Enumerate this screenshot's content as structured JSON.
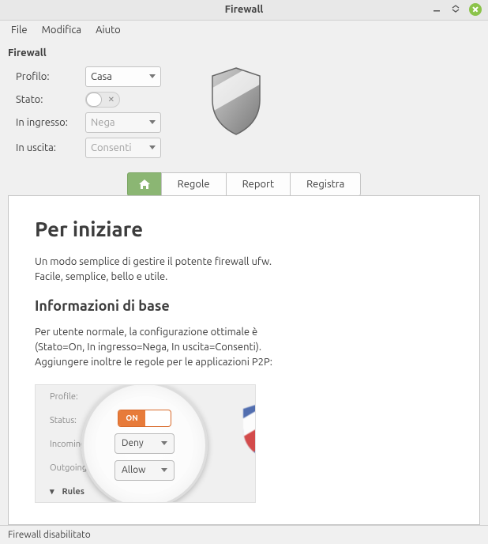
{
  "window": {
    "title": "Firewall"
  },
  "menu": {
    "file": "File",
    "edit": "Modifica",
    "help": "Aiuto"
  },
  "section": {
    "title": "Firewall"
  },
  "settings": {
    "profile_label": "Profilo:",
    "profile_value": "Casa",
    "status_label": "Stato:",
    "incoming_label": "In ingresso:",
    "incoming_value": "Nega",
    "outgoing_label": "In uscita:",
    "outgoing_value": "Consenti"
  },
  "tabs": {
    "rules": "Regole",
    "report": "Report",
    "log": "Registra"
  },
  "intro": {
    "heading": "Per iniziare",
    "body": "Un modo semplice di gestire il potente firewall ufw. Facile, semplice, bello e utile.",
    "basics_heading": "Informazioni di base",
    "basics_body": "Per utente normale, la configurazione ottimale è (Stato=On, In ingresso=Nega, In uscita=Consenti). Aggiungere inoltre le regole per le applicazioni P2P:"
  },
  "illus": {
    "profile": "Profile:",
    "status": "Status:",
    "incoming": "Incoming:",
    "outgoing": "Outgoing:",
    "rules": "Rules",
    "on": "ON",
    "deny": "Deny",
    "allow": "Allow"
  },
  "status": {
    "text": "Firewall disabilitato"
  }
}
